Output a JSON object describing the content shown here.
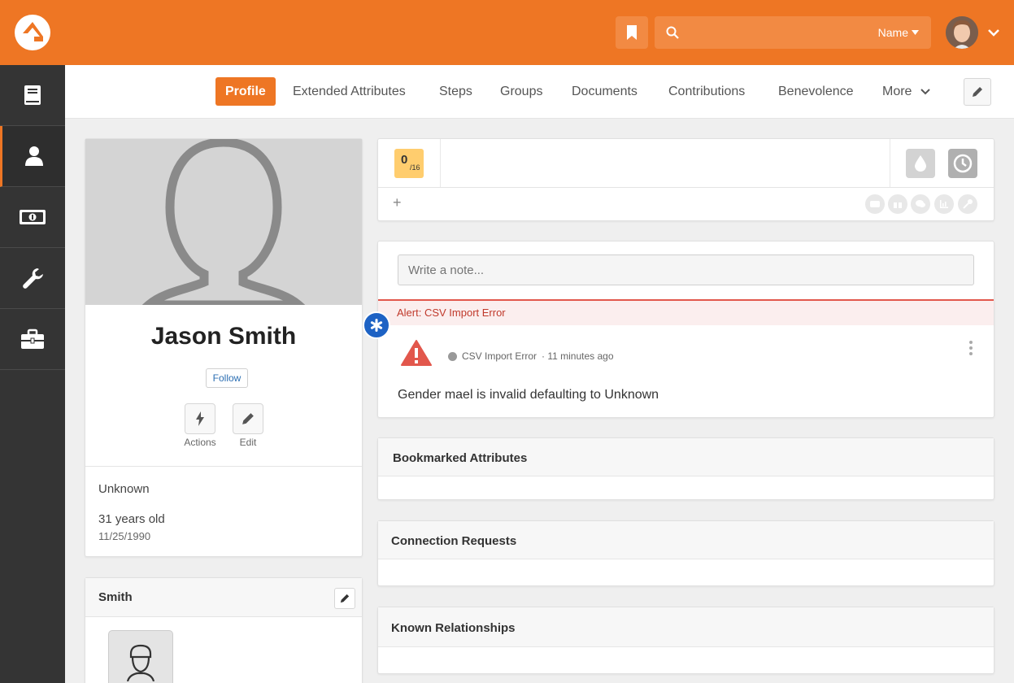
{
  "header": {
    "search": {
      "placeholder": "",
      "filter_label": "Name"
    },
    "colors": {
      "brand": "#ee7624",
      "sidebar": "#343434"
    }
  },
  "sidebar": {
    "items": [
      {
        "icon": "book-icon"
      },
      {
        "icon": "user-icon",
        "active": true
      },
      {
        "icon": "money-icon"
      },
      {
        "icon": "wrench-icon"
      },
      {
        "icon": "briefcase-icon"
      }
    ]
  },
  "tabs": [
    {
      "label": "Profile",
      "active": true
    },
    {
      "label": "Extended Attributes"
    },
    {
      "label": "Steps"
    },
    {
      "label": "Groups"
    },
    {
      "label": "Documents"
    },
    {
      "label": "Contributions"
    },
    {
      "label": "Benevolence"
    },
    {
      "label": "More"
    }
  ],
  "profile": {
    "name": "Jason Smith",
    "follow_label": "Follow",
    "actions_label": "Actions",
    "edit_label": "Edit",
    "gender": "Unknown",
    "age": "31 years old",
    "birthdate": "11/25/1990"
  },
  "family": {
    "title": "Smith"
  },
  "badges": {
    "score": "0",
    "score_total": "/16",
    "add_label": "+"
  },
  "notes": {
    "placeholder": "Write a note...",
    "alert_text": "Alert: CSV Import Error",
    "note_type": "CSV Import Error",
    "note_time": "· 11 minutes ago",
    "note_body": "Gender mael is invalid defaulting to Unknown"
  },
  "sections": {
    "bookmarked": "Bookmarked Attributes",
    "connections": "Connection Requests",
    "relationships": "Known Relationships"
  }
}
